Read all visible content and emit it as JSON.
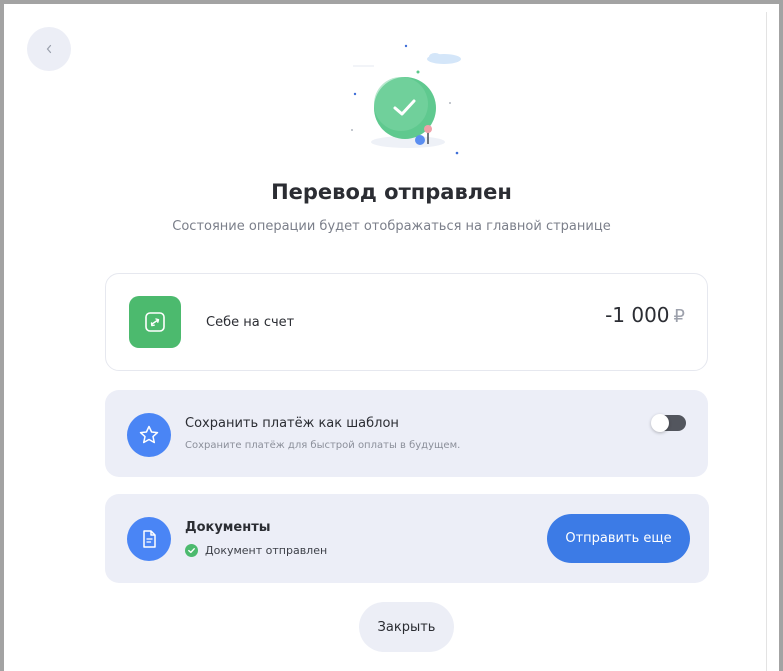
{
  "header": {
    "title": "Перевод отправлен",
    "subtitle": "Состояние операции будет отображаться на главной странице"
  },
  "transfer": {
    "label": "Себе на счет",
    "amount": "-1 000",
    "currency": "₽"
  },
  "template": {
    "title": "Сохранить платёж как шаблон",
    "subtitle": "Сохраните платёж для быстрой оплаты в будущем.",
    "enabled": false
  },
  "documents": {
    "title": "Документы",
    "status": "Документ отправлен",
    "send_again_label": "Отправить еще"
  },
  "footer": {
    "close_label": "Закрыть"
  },
  "icons": {
    "back": "chevron-left-icon",
    "transfer": "arrows-exchange-icon",
    "template": "star-icon",
    "documents": "document-icon",
    "status": "check-circle-icon",
    "illustration": "success-check-illustration"
  },
  "colors": {
    "success": "#4cba6e",
    "accent": "#4a85f5",
    "primary_button": "#3c7be6",
    "card_bg": "#eceef7"
  }
}
